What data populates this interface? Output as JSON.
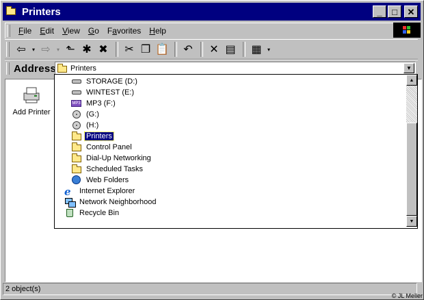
{
  "window": {
    "title": "Printers",
    "buttons": {
      "minimize": "_",
      "maximize": "□",
      "close": "✕"
    }
  },
  "menubar": {
    "items": [
      {
        "mnemonic": "F",
        "rest": "ile"
      },
      {
        "mnemonic": "E",
        "rest": "dit"
      },
      {
        "mnemonic": "V",
        "rest": "iew"
      },
      {
        "mnemonic": "G",
        "rest": "o"
      },
      {
        "pre": "F",
        "mnemonic": "a",
        "rest": "vorites"
      },
      {
        "mnemonic": "H",
        "rest": "elp"
      }
    ]
  },
  "toolbar": {
    "back": "⇦",
    "back_dd": "▾",
    "forward": "⇨",
    "forward_dd": "▾",
    "up": "⬑",
    "map_drive": "✱",
    "disconnect": "✖",
    "cut": "✂",
    "copy": "❐",
    "paste": "📋",
    "undo": "↶",
    "delete": "✕",
    "properties": "▤",
    "views": "▦",
    "views_dd": "▾"
  },
  "address": {
    "label": "Address",
    "value": "Printers",
    "dropdown_arrow": "▼"
  },
  "desktop_item": {
    "label": "Add Printer",
    "icon": "add-printer-icon"
  },
  "dropdown": {
    "items": [
      {
        "label": "STORAGE (D:)",
        "icon": "drive",
        "indent": 2
      },
      {
        "label": "WINTEST (E:)",
        "icon": "drive",
        "indent": 2
      },
      {
        "label": "MP3 (F:)",
        "icon": "mp3",
        "indent": 2
      },
      {
        "label": "(G:)",
        "icon": "cd",
        "indent": 2
      },
      {
        "label": "(H:)",
        "icon": "cd",
        "indent": 2
      },
      {
        "label": "Printers",
        "icon": "folder",
        "indent": 2,
        "selected": true
      },
      {
        "label": "Control Panel",
        "icon": "folder",
        "indent": 2
      },
      {
        "label": "Dial-Up Networking",
        "icon": "folder",
        "indent": 2
      },
      {
        "label": "Scheduled Tasks",
        "icon": "folder",
        "indent": 2
      },
      {
        "label": "Web Folders",
        "icon": "globe",
        "indent": 2
      },
      {
        "label": "Internet Explorer",
        "icon": "ie",
        "indent": 1
      },
      {
        "label": "Network Neighborhood",
        "icon": "net",
        "indent": 1
      },
      {
        "label": "Recycle Bin",
        "icon": "bin",
        "indent": 1
      }
    ],
    "scroll": {
      "up": "▲",
      "down": "▼"
    }
  },
  "status": {
    "text": "2 object(s)"
  },
  "watermark": "© JL Meller",
  "colors": {
    "titlebar": "#000080",
    "selection": "#000080",
    "face": "#c0c0c0"
  }
}
